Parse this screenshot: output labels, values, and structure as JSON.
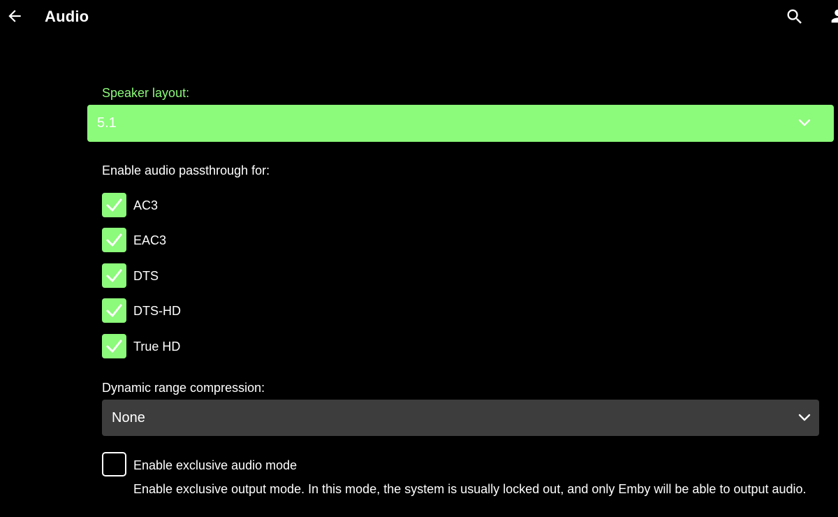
{
  "header": {
    "title": "Audio",
    "back_icon": "arrow-left-icon",
    "search_icon": "search-icon",
    "user_icon": "user-icon"
  },
  "speaker_layout": {
    "label": "Speaker layout:",
    "value": "5.1",
    "accent_color": "#8cfa7a"
  },
  "passthrough": {
    "label": "Enable audio passthrough for:",
    "options": [
      {
        "label": "AC3",
        "checked": true
      },
      {
        "label": "EAC3",
        "checked": true
      },
      {
        "label": "DTS",
        "checked": true
      },
      {
        "label": "DTS-HD",
        "checked": true
      },
      {
        "label": "True HD",
        "checked": true
      }
    ]
  },
  "drc": {
    "label": "Dynamic range compression:",
    "value": "None",
    "background_color": "#3d3d3d"
  },
  "exclusive_mode": {
    "label": "Enable exclusive audio mode",
    "checked": false,
    "description": "Enable exclusive output mode. In this mode, the system is usually locked out, and only Emby will be able to output audio."
  }
}
